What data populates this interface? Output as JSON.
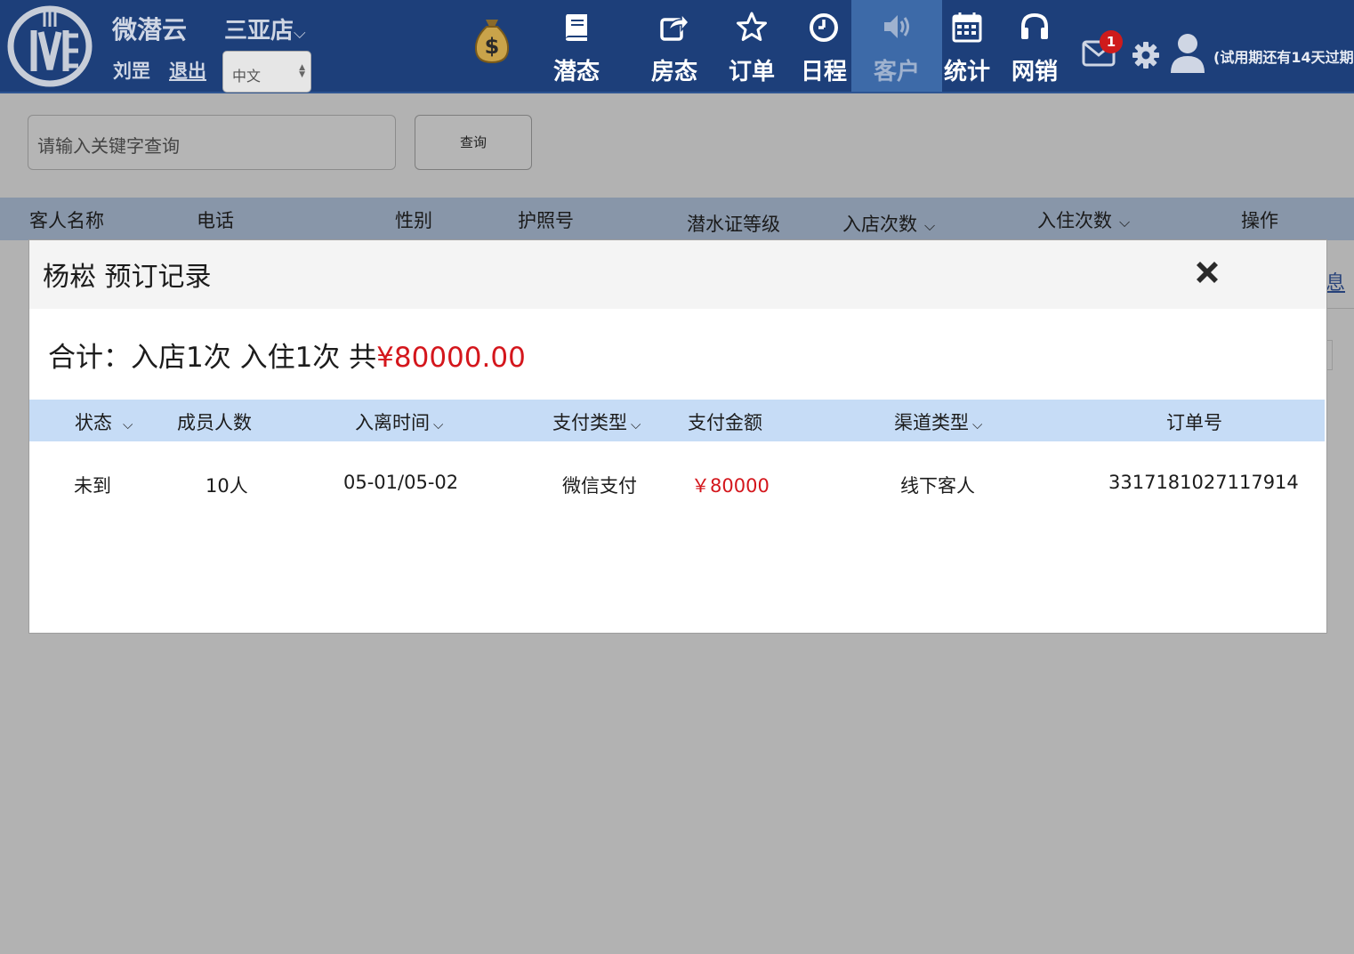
{
  "header": {
    "brand": "微潜云",
    "store": "三亚店",
    "store_caret": "⌵",
    "user": "刘罡",
    "logout": "退出",
    "language": "中文",
    "nav": [
      {
        "label": "潜态",
        "icon": "book-icon"
      },
      {
        "label": "房态",
        "icon": "share-icon"
      },
      {
        "label": "订单",
        "icon": "star-icon"
      },
      {
        "label": "日程",
        "icon": "clock-icon"
      },
      {
        "label": "客户",
        "icon": "speaker-icon",
        "active": true
      },
      {
        "label": "统计",
        "icon": "calendar-icon"
      },
      {
        "label": "网销",
        "icon": "headphones-icon"
      }
    ],
    "notifications": "1",
    "trial_notice": "(试用期还有14天过期"
  },
  "search": {
    "placeholder": "请输入关键字查询",
    "button": "查询"
  },
  "customer_table": {
    "columns": [
      "客人名称",
      "电话",
      "性别",
      "护照号",
      "潜水证等级",
      "入店次数",
      "入住次数",
      "操作"
    ],
    "partial_link": "息"
  },
  "modal": {
    "title": "杨崧 预订记录",
    "summary_prefix": "合计：入店1次 入住1次 共",
    "summary_amount": "¥80000.00",
    "columns": [
      "状态",
      "成员人数",
      "入离时间",
      "支付类型",
      "支付金额",
      "渠道类型",
      "订单号"
    ],
    "rows": [
      {
        "status": "未到",
        "members": "10人",
        "dates": "05-01/05-02",
        "pay_type": "微信支付",
        "amount": "￥80000",
        "channel": "线下客人",
        "order_no": "3317181027117914"
      }
    ]
  },
  "colors": {
    "topbar": "#1d3f7a",
    "active_nav": "#3d6aa8",
    "overlay": "#b2b2b2",
    "modal_subheader": "#c6dcf6",
    "amount_red": "#d4161c",
    "badge_red": "#cf1b1b"
  }
}
